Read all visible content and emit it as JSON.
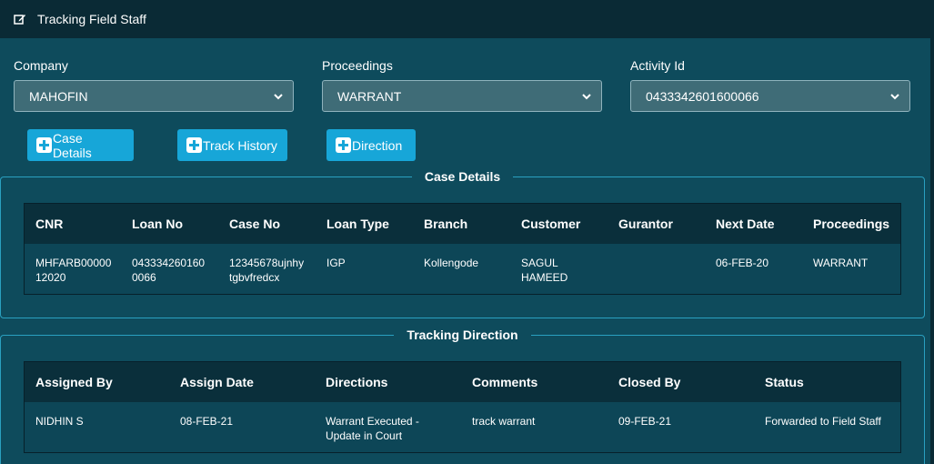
{
  "app": {
    "title": "Tracking Field Staff",
    "title_icon": "edit-icon"
  },
  "filters": {
    "company": {
      "label": "Company",
      "value": "MAHOFIN"
    },
    "proceedings": {
      "label": "Proceedings",
      "value": "WARRANT"
    },
    "activity": {
      "label": "Activity Id",
      "value": "043334260160006​6"
    }
  },
  "buttons": {
    "case_details": "Case Details",
    "track_history": "Track History",
    "direction": "Direction"
  },
  "case_details": {
    "legend": "Case Details",
    "columns": [
      "CNR",
      "Loan No",
      "Case No",
      "Loan Type",
      "Branch",
      "Customer",
      "Gurantor",
      "Next Date",
      "Proceedings"
    ],
    "rows": [
      {
        "cnr_line1": "MHFARB00000",
        "cnr_line2": "12020",
        "loan_line1": "043334260160",
        "loan_line2": "0066",
        "case_line1": "12345678ujnhy",
        "case_line2": "tgbvfredcx",
        "loan_type": "IGP",
        "branch": "Kollengode",
        "customer_line1": "SAGUL",
        "customer_line2": "HAMEED",
        "gurantor": "",
        "next_date": "06-FEB-20",
        "proceedings": "WARRANT"
      }
    ]
  },
  "tracking_direction": {
    "legend": "Tracking Direction",
    "columns": [
      "Assigned By",
      "Assign Date",
      "Directions",
      "Comments",
      "Closed By",
      "Status"
    ],
    "rows": [
      {
        "assigned_by": "NIDHIN S",
        "assign_date": "08-FEB-21",
        "direction_line1": "Warrant Executed -",
        "direction_line2": "Update in Court",
        "comments": "track warrant",
        "closed_by": "09-FEB-21",
        "status": "Forwarded to Field Staff"
      }
    ]
  }
}
